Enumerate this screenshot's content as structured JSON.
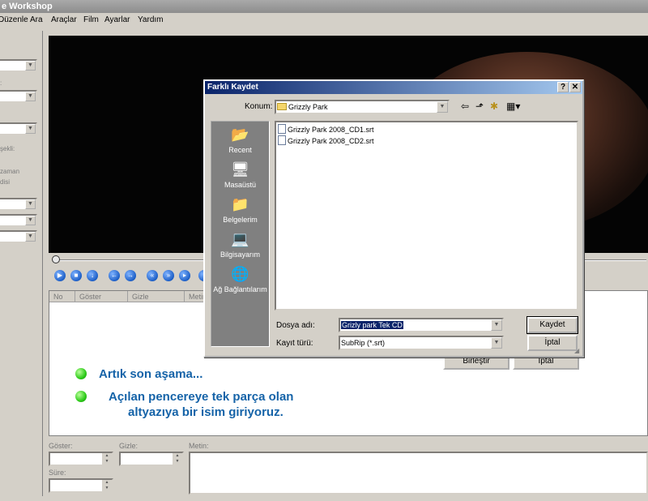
{
  "app": {
    "title": "e Workshop"
  },
  "menu": [
    "Düzenle",
    "Ara",
    "Araçlar",
    "Film",
    "Ayarlar",
    "Yardım"
  ],
  "left_panel": {
    "labels": [
      "şekli:",
      "zaman",
      "disi"
    ]
  },
  "player": {
    "controls": [
      "play-icon",
      "stop-icon",
      "down-icon",
      "back-icon",
      "forward-icon",
      "rewind-icon",
      "fast-forward-icon",
      "next-icon"
    ]
  },
  "list": {
    "columns": [
      "No",
      "Göster",
      "Gizle",
      "Metin"
    ]
  },
  "bottom": {
    "show_label": "Göster:",
    "hide_label": "Gizle:",
    "text_label": "Metin:",
    "duration_label": "Süre:"
  },
  "background_buttons": {
    "merge": "Birleştir",
    "cancel": "İptal"
  },
  "annotations": {
    "line1": "Artık son aşama...",
    "line2": "Açılan pencereye tek parça olan",
    "line3": "altyazıya bir isim giriyoruz."
  },
  "dialog": {
    "title": "Farklı Kaydet",
    "help": "?",
    "close": "✕",
    "location_label": "Konum:",
    "location_value": "Grizzly Park",
    "places": [
      "Recent",
      "Masaüstü",
      "Belgelerim",
      "Bilgisayarım",
      "Ağ Bağlantılarım"
    ],
    "files": [
      "Grizzly Park 2008_CD1.srt",
      "Grizzly Park 2008_CD2.srt"
    ],
    "filename_label": "Dosya adı:",
    "filename_value": "Grizly park Tek CD",
    "filetype_label": "Kayıt türü:",
    "filetype_value": "SubRip (*.srt)",
    "save_button": "Kaydet",
    "cancel_button": "İptal"
  }
}
